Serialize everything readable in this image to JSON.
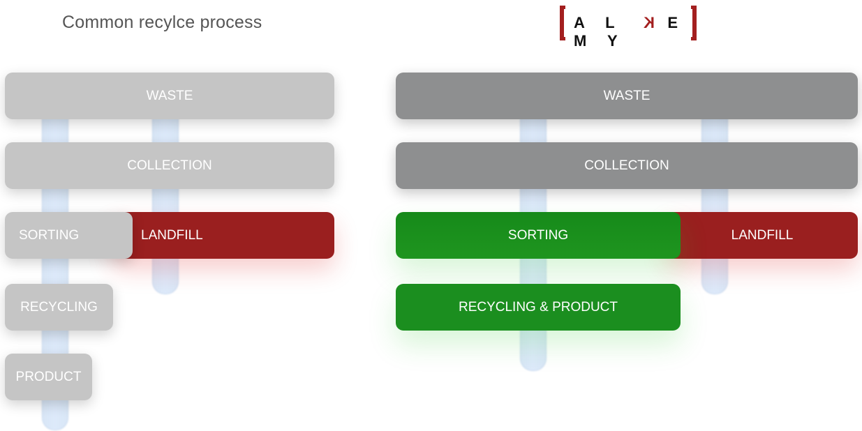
{
  "title": "Common recylce process",
  "logo": {
    "text_a": "A L",
    "text_k": "K",
    "text_b": "E M Y"
  },
  "left": {
    "waste": "WASTE",
    "collection": "COLLECTION",
    "sorting": "SORTING",
    "landfill": "LANDFILL",
    "recycling": "RECYCLING",
    "product": "PRODUCT"
  },
  "right": {
    "waste": "WASTE",
    "collection": "COLLECTION",
    "sorting": "SORTING",
    "landfill": "LANDFILL",
    "recycling_product": "RECYCLING & PRODUCT"
  },
  "colors": {
    "light_gray": "#c5c5c5",
    "dark_gray": "#8e8f90",
    "landfill_red": "#9a1f1f",
    "sorting_green": "#1b8e1f",
    "logo_red": "#a31f1f"
  }
}
